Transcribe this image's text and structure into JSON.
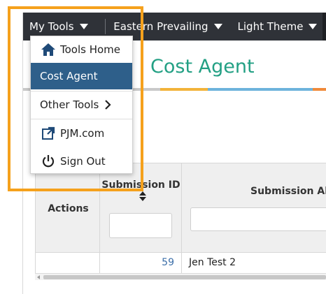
{
  "topbar": {
    "my_tools": "My Tools",
    "region": "Eastern Prevailing",
    "theme": "Light Theme"
  },
  "header": {
    "title": "Cost Agent"
  },
  "menu": {
    "items": [
      {
        "label": "Tools Home",
        "icon": "home-icon"
      },
      {
        "label": "Cost Agent",
        "icon": ""
      },
      {
        "label": "Other Tools",
        "icon": "chevron-right-icon"
      },
      {
        "label": "PJM.com",
        "icon": "external-link-icon"
      },
      {
        "label": "Sign Out",
        "icon": "power-icon"
      }
    ]
  },
  "grid": {
    "columns": [
      "Actions",
      "Submission ID",
      "Submission Al"
    ],
    "rows": [
      {
        "actions": "",
        "submission_id": "59",
        "submission_alias": "Jen Test 2"
      }
    ]
  },
  "colors": {
    "accent_green": "#23a084",
    "nav_bg": "#2f3238",
    "selected_bg": "#2e5f8a",
    "highlight": "#f5a11c"
  }
}
